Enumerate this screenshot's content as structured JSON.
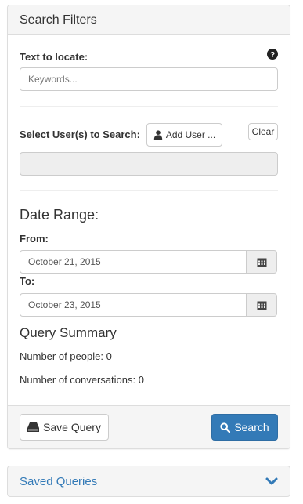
{
  "panel": {
    "title": "Search Filters"
  },
  "text_search": {
    "label": "Text to locate:",
    "placeholder": "Keywords...",
    "help_icon": "question-circle-icon"
  },
  "users": {
    "label": "Select User(s) to Search:",
    "add_button": "Add User ...",
    "clear_button": "Clear",
    "add_icon": "user-icon"
  },
  "date_range": {
    "heading": "Date Range:",
    "from_label": "From:",
    "from_value": "October 21, 2015",
    "to_label": "To:",
    "to_value": "October 23, 2015",
    "calendar_icon": "calendar-icon"
  },
  "summary": {
    "heading": "Query Summary",
    "people": "Number of people: 0",
    "conversations": "Number of conversations: 0"
  },
  "footer": {
    "save_label": "Save Query",
    "search_label": "Search",
    "save_icon": "hdd-icon",
    "search_icon": "search-icon"
  },
  "saved_queries": {
    "title": "Saved Queries",
    "icon": "chevron-down-icon"
  },
  "colors": {
    "primary": "#337ab7",
    "panel_bg": "#f5f5f5",
    "border": "#dddddd"
  }
}
